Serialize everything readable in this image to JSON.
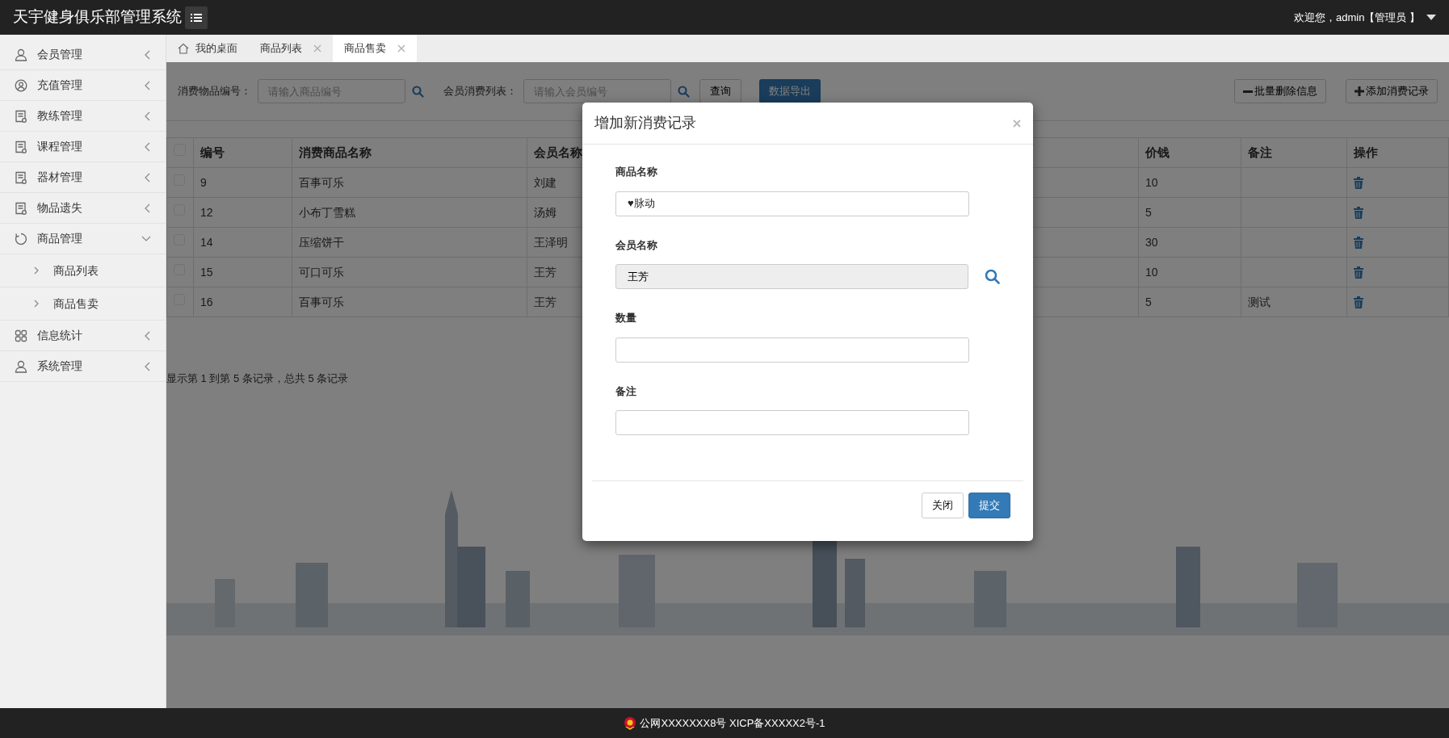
{
  "app": {
    "title": "天宇健身俱乐部管理系统",
    "user_menu": "欢迎您，admin【管理员 】"
  },
  "sidebar": {
    "items": [
      {
        "label": "会员管理",
        "kind": "user",
        "expanded": false
      },
      {
        "label": "充值管理",
        "kind": "badge",
        "expanded": false
      },
      {
        "label": "教练管理",
        "kind": "doc",
        "expanded": false
      },
      {
        "label": "课程管理",
        "kind": "doc",
        "expanded": false
      },
      {
        "label": "器材管理",
        "kind": "doc",
        "expanded": false
      },
      {
        "label": "物品遗失",
        "kind": "doc",
        "expanded": false
      },
      {
        "label": "商品管理",
        "kind": "cycle",
        "expanded": true,
        "children": [
          {
            "label": "商品列表"
          },
          {
            "label": "商品售卖"
          }
        ]
      },
      {
        "label": "信息统计",
        "kind": "grid",
        "expanded": false
      },
      {
        "label": "系统管理",
        "kind": "user",
        "expanded": false
      }
    ]
  },
  "tabs": [
    {
      "label": "我的桌面",
      "kind": "home",
      "selected": false
    },
    {
      "label": "商品列表",
      "kind": "closable",
      "selected": false
    },
    {
      "label": "商品售卖",
      "kind": "closable",
      "selected": true
    }
  ],
  "toolbar": {
    "fields": [
      {
        "label": "消费物品编号：",
        "placeholder": "请输入商品编号"
      },
      {
        "label": "会员消费列表：",
        "placeholder": "请输入会员编号"
      }
    ],
    "query_button": "查询",
    "export_button": "数据导出",
    "actions": [
      {
        "label": "批量删除信息",
        "kind": "remove"
      },
      {
        "label": "添加消费记录",
        "kind": "add"
      }
    ]
  },
  "table": {
    "header_checked": false,
    "columns": [
      "编号",
      "消费商品名称",
      "会员名称",
      "价钱",
      "备注",
      "操作"
    ],
    "rows": [
      {
        "checked": false,
        "id": "9",
        "product": "百事可乐",
        "member": "刘建",
        "price": "10"
      },
      {
        "checked": false,
        "id": "12",
        "product": "小布丁雪糕",
        "member": "汤姆",
        "price": "5"
      },
      {
        "checked": false,
        "id": "14",
        "product": "压缩饼干",
        "member": "王泽明",
        "price": "30"
      },
      {
        "checked": false,
        "id": "15",
        "product": "可口可乐",
        "member": "王芳",
        "price": "10"
      },
      {
        "checked": false,
        "id": "16",
        "product": "百事可乐",
        "member": "王芳",
        "price": "5",
        "note": "测试"
      }
    ]
  },
  "pager": "显示第 1 到第 5 条记录，总共 5 条记录",
  "modal": {
    "title": "增加新消费记录",
    "fields": [
      {
        "label": "商品名称",
        "kind": "select",
        "value": "♥脉动"
      },
      {
        "label": "会员名称",
        "kind": "readonly",
        "value": "王芳"
      },
      {
        "label": "数量",
        "kind": "text"
      },
      {
        "label": "备注",
        "kind": "text"
      }
    ],
    "buttons": [
      {
        "label": "关闭",
        "kind": "default"
      },
      {
        "label": "提交",
        "kind": "primary"
      }
    ]
  },
  "footer": "公网XXXXXXX8号 XICP备XXXXX2号-1"
}
